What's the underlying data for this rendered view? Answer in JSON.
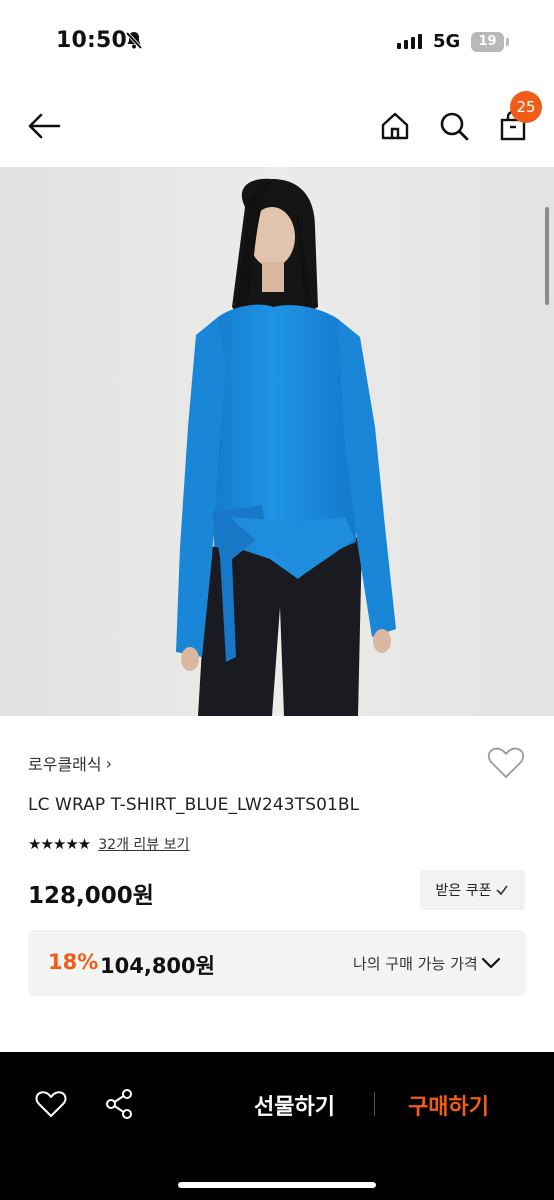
{
  "status_bar": {
    "time": "10:50",
    "network": "5G",
    "battery": "19"
  },
  "header": {
    "back_icon": "arrow-left-icon",
    "home_icon": "home-icon",
    "search_icon": "search-icon",
    "cart_icon": "shopping-bag-icon",
    "cart_count": "25"
  },
  "product": {
    "brand": "로우클래식",
    "brand_chevron": "›",
    "title": "LC WRAP T-SHIRT_BLUE_LW243TS01BL",
    "rating_stars": "★★★★★",
    "rating": 5,
    "review_link": "32개 리뷰 보기",
    "price": "128,000원",
    "coupon_label": "받은 쿠폰",
    "best_price": {
      "discount": "18%",
      "price": "104,800원",
      "label": "나의 구매 가능 가격"
    }
  },
  "bottom_bar": {
    "gift_label": "선물하기",
    "buy_label": "구매하기"
  },
  "colors": {
    "accent": "#f25c19",
    "shirt": "#1a8fe0",
    "hero_bg": "#e5e5e3",
    "bottom_bar": "#000000"
  }
}
